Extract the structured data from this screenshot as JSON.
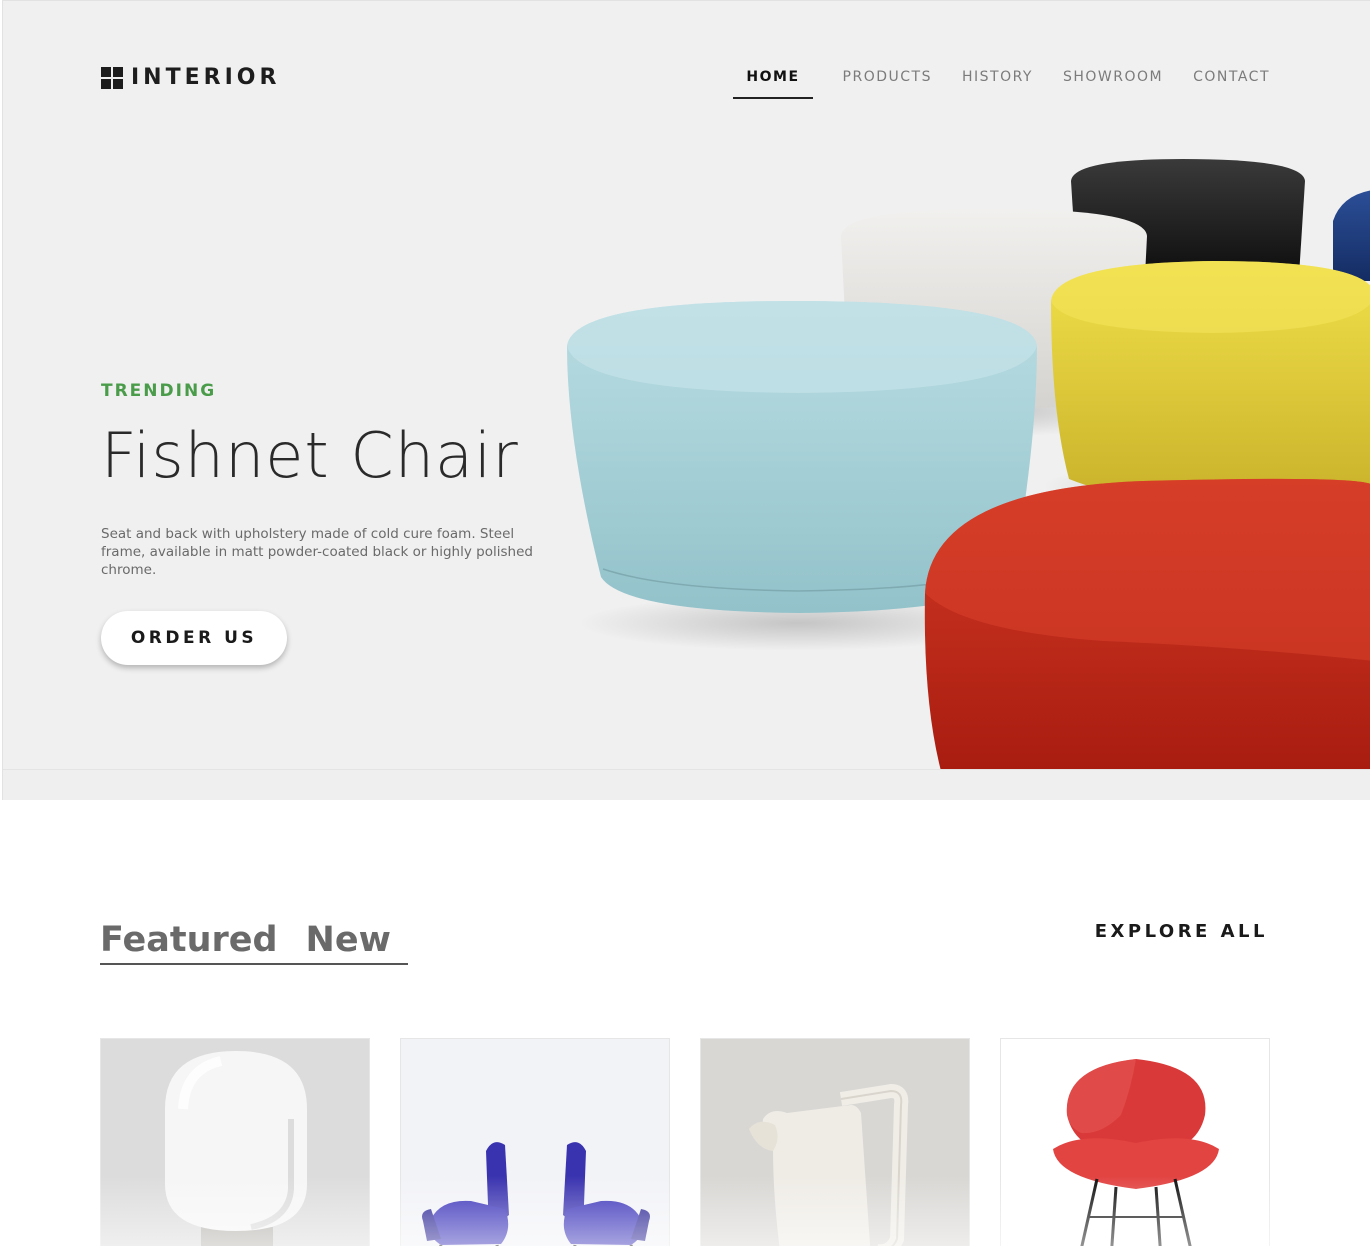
{
  "brand": {
    "name": "INTERIOR",
    "logo_icon": "four-squares-icon"
  },
  "nav": {
    "items": [
      {
        "label": "HOME",
        "active": true
      },
      {
        "label": "PRODUCTS",
        "active": false
      },
      {
        "label": "HISTORY",
        "active": false
      },
      {
        "label": "SHOWROOM",
        "active": false
      },
      {
        "label": "CONTACT",
        "active": false
      }
    ]
  },
  "hero": {
    "eyebrow": "TRENDING",
    "title": "Fishnet Chair",
    "description": "Seat and back with upholstery made of cold cure foam. Steel frame, available in matt powder-coated black or highly polished chrome.",
    "cta_label": "ORDER US",
    "image": "colorful-pouf-ottomans",
    "pouf_colors": [
      "#a9d4db",
      "#e6e4e0",
      "#1f1f1f",
      "#1d3f86",
      "#ead83a",
      "#c8321f"
    ]
  },
  "featured": {
    "tabs": [
      "Featured",
      "New"
    ],
    "explore_label": "EXPLORE ALL",
    "products": [
      {
        "image": "white-egg-lamp"
      },
      {
        "image": "blue-armchairs-pair"
      },
      {
        "image": "white-ceramic-pitcher"
      },
      {
        "image": "red-shell-chair"
      }
    ]
  },
  "colors": {
    "accent_green": "#4a9c4a",
    "hero_background": "#f0f0f0",
    "text_dark": "#1a1a1a"
  }
}
